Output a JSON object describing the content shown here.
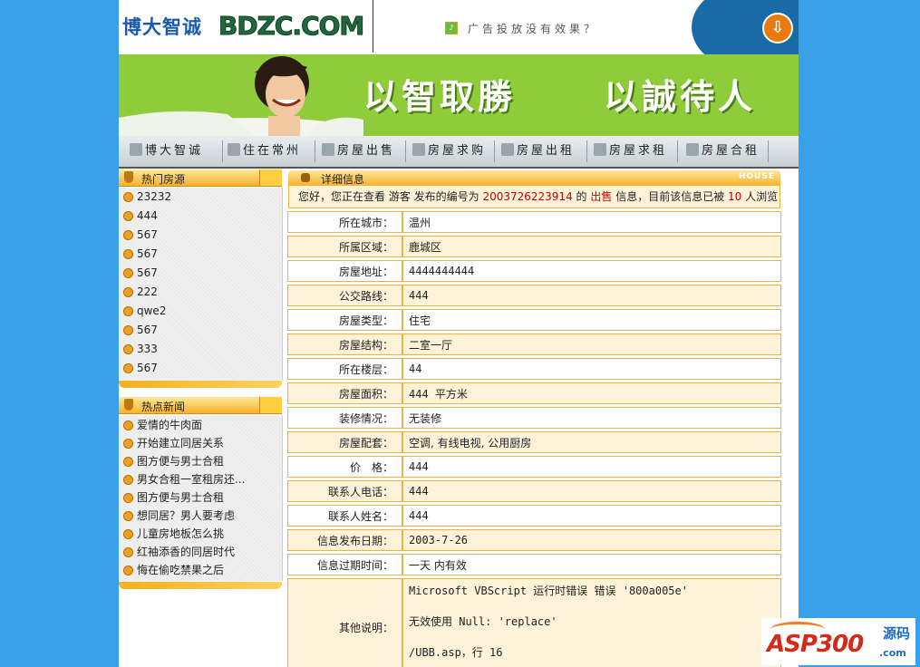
{
  "header": {
    "logo_cn": "博大智诚",
    "logo_en": "BDZC.COM",
    "ad_text": "广告投放没有效果？"
  },
  "banner": {
    "slogan_left": "以智取勝",
    "slogan_right": "以誠待人"
  },
  "nav": [
    {
      "label": "博大智诚",
      "icon": "globe-icon"
    },
    {
      "label": "住在常州",
      "icon": "building-icon"
    },
    {
      "label": "房屋出售",
      "icon": "document-icon"
    },
    {
      "label": "房屋求购",
      "icon": "list-icon"
    },
    {
      "label": "房屋出租",
      "icon": "folder-icon"
    },
    {
      "label": "房屋求租",
      "icon": "search-icon"
    },
    {
      "label": "房屋合租",
      "icon": "people-icon"
    }
  ],
  "hot_houses": {
    "title": "热门房源",
    "items": [
      "23232",
      "444",
      "567",
      "567",
      "567",
      "222",
      "qwe2",
      "567",
      "333",
      "567"
    ]
  },
  "hot_news": {
    "title": "热点新闻",
    "items": [
      "爱情的牛肉面",
      "开始建立同居关系",
      "图方便与男士合租",
      "男女合租一室租房还...",
      "图方便与男士合租",
      "想同居？男人要考虑",
      "儿童房地板怎么挑",
      "红袖添香的同居时代",
      "悔在偷吃禁果之后"
    ]
  },
  "detail": {
    "title": "详细信息",
    "tag": "HOUSE",
    "welcome": {
      "prefix": "您好，您正在查看 游客 发布的编号为 ",
      "number": "2003726223914",
      "mid1": " 的 ",
      "type": "出售",
      "mid2": " 信息，目前该信息已被 ",
      "views": "10",
      "suffix": " 人浏览"
    },
    "rows": [
      {
        "label": "所在城市：",
        "value": "温州"
      },
      {
        "label": "所属区域：",
        "value": "鹿城区"
      },
      {
        "label": "房屋地址：",
        "value": "4444444444"
      },
      {
        "label": "公交路线：",
        "value": "444"
      },
      {
        "label": "房屋类型：",
        "value": "住宅"
      },
      {
        "label": "房屋结构：",
        "value": "二室一厅"
      },
      {
        "label": "所在楼层：",
        "value": "44"
      },
      {
        "label": "房屋面积：",
        "value": "444 平方米"
      },
      {
        "label": "装修情况：",
        "value": "无装修"
      },
      {
        "label": "房屋配套：",
        "value": "空调, 有线电视, 公用厨房"
      },
      {
        "label": "价　格：",
        "value": "444"
      },
      {
        "label": "联系人电话：",
        "value": "444"
      },
      {
        "label": "联系人姓名：",
        "value": "444"
      },
      {
        "label": "信息发布日期：",
        "value": "2003-7-26"
      },
      {
        "label": "信息过期时间：",
        "value": "一天 内有效"
      }
    ],
    "other": {
      "label": "其他说明：",
      "lines": [
        "Microsoft VBScript 运行时错误 错误 '800a005e'",
        "无效使用 Null: 'replace'",
        "/UBB.asp，行 16"
      ]
    }
  },
  "watermark": {
    "brand": "ASP300",
    "suffix_cn": "源码",
    "suffix_en": ".com"
  },
  "colors": {
    "background": "#3aa0e8",
    "banner_green": "#8fcc3a",
    "accent_orange": "#f6b22c",
    "highlight_red": "#c00000"
  }
}
